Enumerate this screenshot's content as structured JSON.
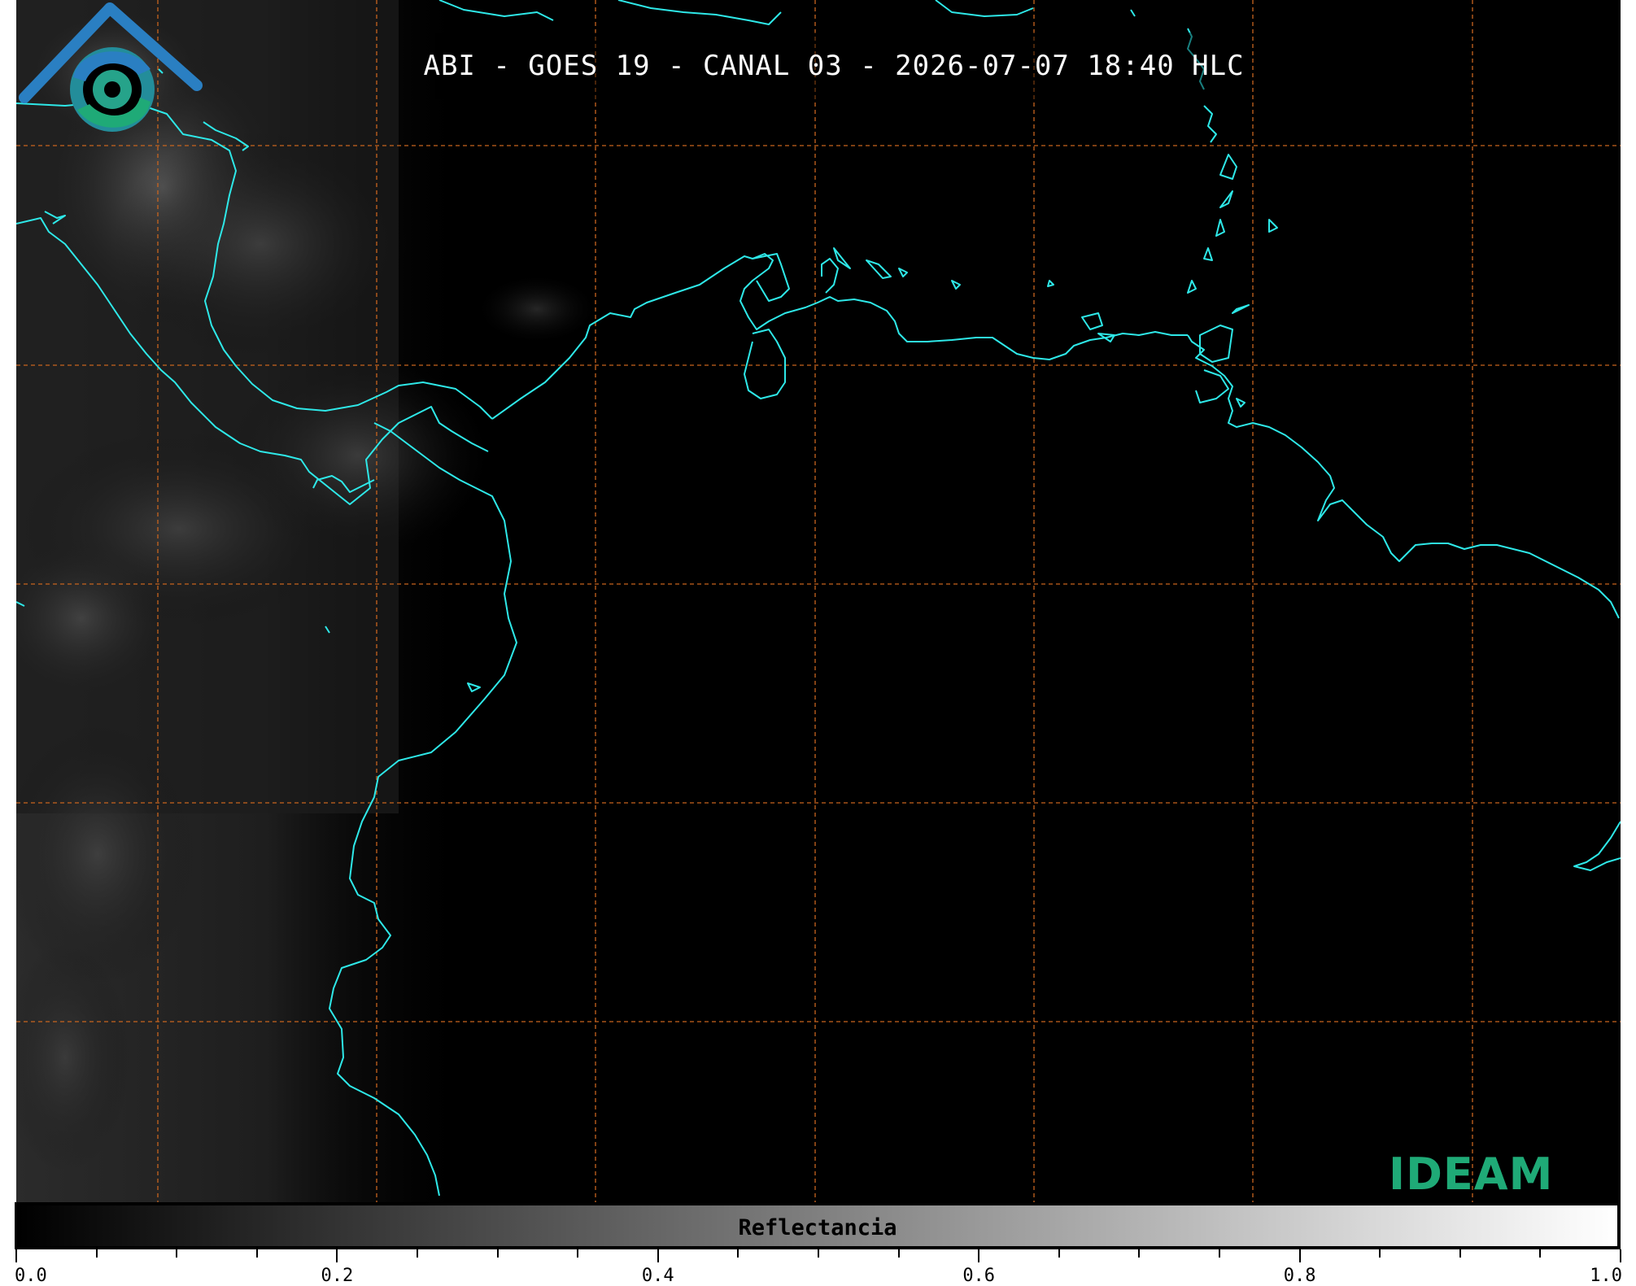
{
  "title": "ABI - GOES 19 - CANAL 03 - 2026-07-07 18:40 HLC",
  "colors": {
    "coastline": "#2ee8e8",
    "graticule": "#c8641e",
    "background": "#000000",
    "logo_blue": "#2a7fc2",
    "logo_green": "#1faa77"
  },
  "logo": {
    "text": "IDEAM",
    "icon": "ideam-logo-icon"
  },
  "colorbar": {
    "label": "Reflectancia",
    "range": [
      0.0,
      1.0
    ],
    "colormap": "grayscale",
    "tick_labels": [
      "0.0",
      "0.2",
      "0.4",
      "0.6",
      "0.8",
      "1.0"
    ],
    "tick_values": [
      0.0,
      0.2,
      0.4,
      0.6,
      0.8,
      1.0
    ],
    "minor_tick_step": 0.05
  },
  "map": {
    "layers": [
      "coastline",
      "graticule",
      "cloud-reflectance"
    ],
    "graticule_style": "dashed"
  }
}
